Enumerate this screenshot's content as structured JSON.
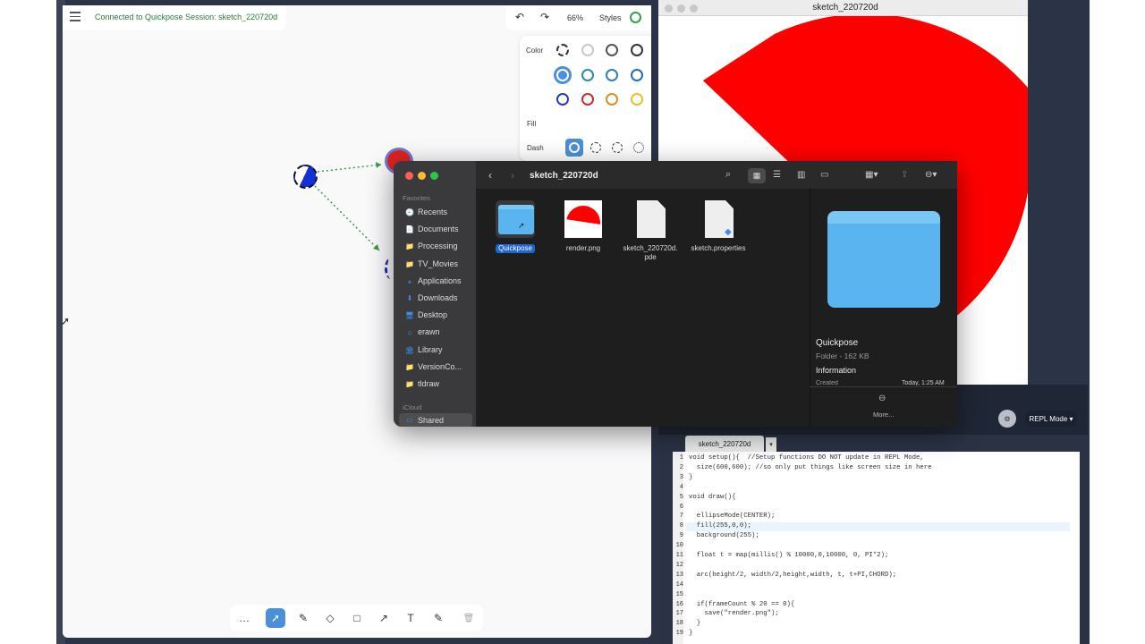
{
  "tldraw": {
    "session_text": "Connected to Quickpose Session: sketch_220720d",
    "zoom": "66%",
    "styles_label": "Styles",
    "panel": {
      "color_label": "Color",
      "fill_label": "Fill",
      "dash_label": "Dash",
      "colors": [
        "#333333",
        "#c8c8c8",
        "#555555",
        "#333333",
        "#4a90d9",
        "#2b8ab0",
        "#2f7fb8",
        "#2a6ab0",
        "#2a3cb0",
        "#d02a2a",
        "#e08a2a",
        "#e8c02a"
      ]
    },
    "toolbar": {
      "more": "…",
      "tools": [
        "select-icon",
        "pencil-icon",
        "eraser-icon",
        "rectangle-icon",
        "arrow-icon",
        "text-icon",
        "edit-icon",
        "trash-icon"
      ]
    }
  },
  "output_window": {
    "title": "sketch_220720d"
  },
  "finder": {
    "title": "sketch_220720d",
    "favorites_header": "Favorites",
    "icloud_header": "iCloud",
    "sidebar": [
      "Recents",
      "Documents",
      "Processing",
      "TV_Movies",
      "Applications",
      "Downloads",
      "Desktop",
      "erawn",
      "Library",
      "VersionCo...",
      "tldraw"
    ],
    "icloud_items": [
      "Shared"
    ],
    "files": [
      {
        "name": "Quickpose",
        "selected": true
      },
      {
        "name": "render.png",
        "selected": false
      },
      {
        "name": "sketch_220720d.\npde",
        "selected": false
      },
      {
        "name": "sketch.properties",
        "selected": false
      }
    ],
    "preview": {
      "name": "Quickpose",
      "meta": "Folder - 162 KB",
      "info_header": "Information",
      "created_label": "Created",
      "created_value": "Today, 1:25 AM",
      "more_label": "More..."
    }
  },
  "editor": {
    "mode_label": "REPL Mode",
    "tab_label": "sketch_220720d",
    "lines": [
      "void setup(){  //Setup functions DO NOT update in REPL Mode,",
      "  size(600,600); //so only put things like screen size in here",
      "}",
      "",
      "void draw(){",
      "",
      "  ellipseMode(CENTER);",
      "  fill(255,0,0);",
      "  background(255);",
      "",
      "  float t = map(millis() % 10000,0,10000, 0, PI*2);",
      "",
      "  arc(height/2, width/2,height,width, t, t+PI,CHORD);",
      "",
      "",
      "  if(frameCount % 20 == 0){",
      "    save(\"render.png\");",
      "  }",
      "}"
    ]
  }
}
